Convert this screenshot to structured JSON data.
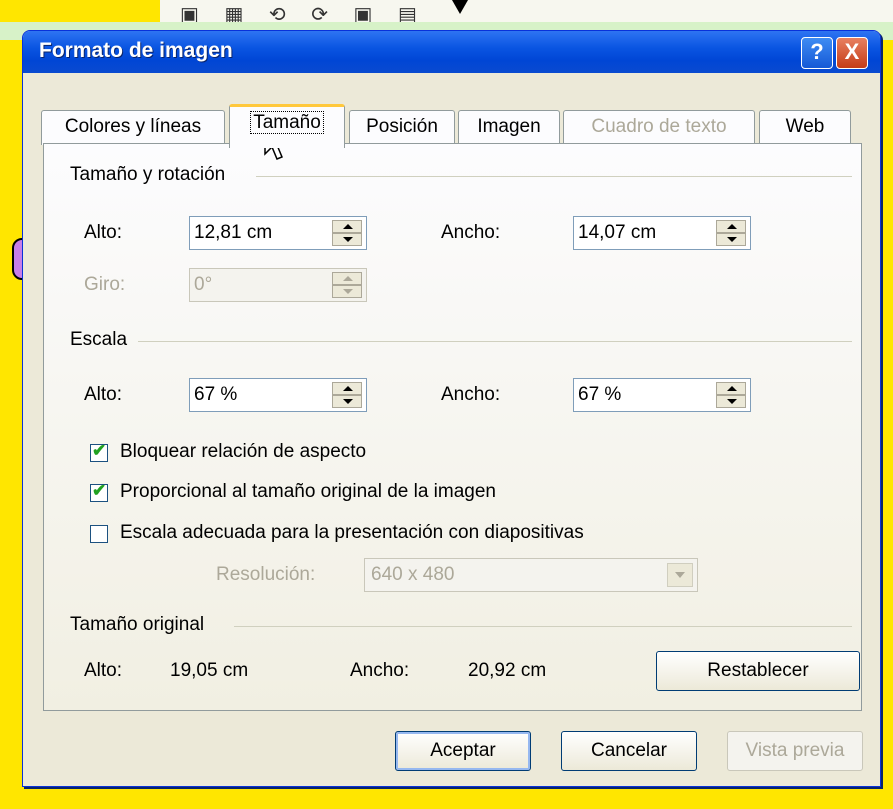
{
  "dialog": {
    "title": "Formato de imagen",
    "help_label": "?",
    "close_label": "X"
  },
  "tabs": [
    {
      "label": "Colores y líneas",
      "state": "normal"
    },
    {
      "label": "Tamaño",
      "state": "active"
    },
    {
      "label": "Posición",
      "state": "normal"
    },
    {
      "label": "Imagen",
      "state": "normal"
    },
    {
      "label": "Cuadro de texto",
      "state": "disabled"
    },
    {
      "label": "Web",
      "state": "normal"
    }
  ],
  "size_rotation": {
    "group_label": "Tamaño y rotación",
    "alto_label": "Alto:",
    "alto_value": "12,81 cm",
    "ancho_label": "Ancho:",
    "ancho_value": "14,07 cm",
    "giro_label": "Giro:",
    "giro_value": "0°"
  },
  "scale": {
    "group_label": "Escala",
    "alto_label": "Alto:",
    "alto_value": "67 %",
    "ancho_label": "Ancho:",
    "ancho_value": "67 %",
    "lock_aspect_label": "Bloquear relación de aspecto",
    "lock_aspect_checked": true,
    "relative_original_label": "Proporcional al tamaño original de la imagen",
    "relative_original_checked": true,
    "best_scale_label": "Escala adecuada para la presentación con diapositivas",
    "best_scale_checked": false,
    "resolution_label": "Resolución:",
    "resolution_value": "640 x 480"
  },
  "original_size": {
    "group_label": "Tamaño original",
    "alto_label": "Alto:",
    "alto_value": "19,05 cm",
    "ancho_label": "Ancho:",
    "ancho_value": "20,92 cm",
    "reset_label": "Restablecer"
  },
  "footer": {
    "ok_label": "Aceptar",
    "cancel_label": "Cancelar",
    "preview_label": "Vista previa"
  },
  "colors": {
    "titlebar": "#0a55e2",
    "dialog_bg": "#ece9d8",
    "active_tab_accent": "#ffc83c",
    "checkmark": "#21a121"
  }
}
